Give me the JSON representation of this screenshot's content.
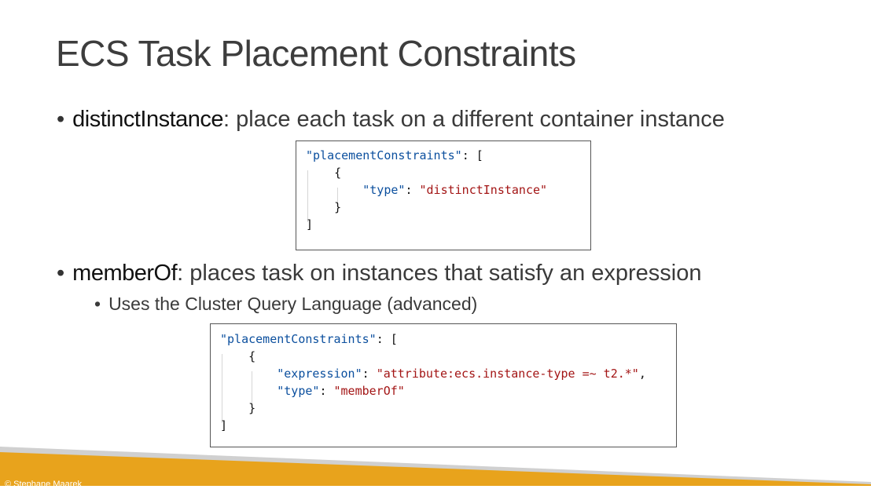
{
  "slide": {
    "title": "ECS Task Placement Constraints",
    "bullet1": {
      "term": "distinctInstance",
      "text": ": place each task on a different container instance"
    },
    "bullet2": {
      "term": "memberOf",
      "text": ": places task on instances that satisfy an expression",
      "sub": "Uses the Cluster Query Language (advanced)"
    },
    "bullet_glyph": "•"
  },
  "code1": {
    "l1_key": "\"placementConstraints\"",
    "l1_rest": ": [",
    "l2": "    {",
    "l3_key": "\"type\"",
    "l3_sep": ": ",
    "l3_val": "\"distinctInstance\"",
    "l4": "    }",
    "l5": "]"
  },
  "code2": {
    "l1_key": "\"placementConstraints\"",
    "l1_rest": ": [",
    "l2": "    {",
    "l3_key": "\"expression\"",
    "l3_sep": ": ",
    "l3_val": "\"attribute:ecs.instance-type =~ t2.*\"",
    "l3_end": ",",
    "l4_key": "\"type\"",
    "l4_sep": ": ",
    "l4_val": "\"memberOf\"",
    "l5": "    }",
    "l6": "]"
  },
  "footer": {
    "copyright": "© Stephane Maarek"
  },
  "colors": {
    "accent_orange": "#e8a31c",
    "accent_gray": "#c9c9c9",
    "code_key": "#0b4f9e",
    "code_string": "#a31515"
  }
}
